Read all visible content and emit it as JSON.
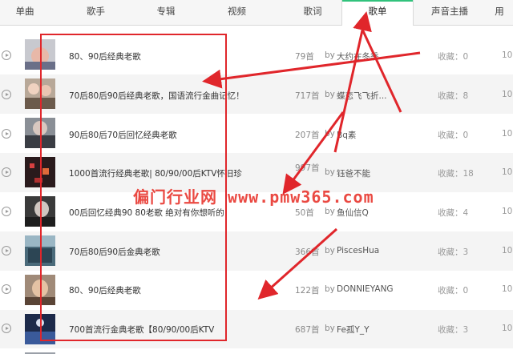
{
  "tabs": [
    {
      "label": "单曲",
      "active": false
    },
    {
      "label": "歌手",
      "active": false
    },
    {
      "label": "专辑",
      "active": false
    },
    {
      "label": "视频",
      "active": false
    },
    {
      "label": "歌词",
      "active": false
    },
    {
      "label": "歌单",
      "active": true
    },
    {
      "label": "声音主播",
      "active": false
    },
    {
      "label": "用",
      "active": false
    }
  ],
  "playlists": [
    {
      "name": "80、90后经典老歌",
      "count": "79首",
      "by": "by",
      "author": "大约在冬季",
      "fav": "收藏：0",
      "edge": "10"
    },
    {
      "name": "70后80后90后经典老歌，国语流行金曲记忆！",
      "count": "717首",
      "by": "by",
      "author": "蝶恋飞飞折...",
      "fav": "收藏：8",
      "edge": "10"
    },
    {
      "name": "90后80后70后回忆经典老歌",
      "count": "207首",
      "by": "by",
      "author": "Bq素",
      "fav": "收藏：0",
      "edge": "10"
    },
    {
      "name": "1000首流行经典老歌| 80/90/00后KTV怀旧珍",
      "count": "997首",
      "by": "by",
      "author": "钰爸不能",
      "fav": "收藏：18",
      "edge": "10"
    },
    {
      "name": "00后回忆经典90 80老歌 绝对有你想听的",
      "count": "50首",
      "by": "by",
      "author": "鱼仙信Q",
      "fav": "收藏：4",
      "edge": "10"
    },
    {
      "name": "70后80后90后金典老歌",
      "count": "366首",
      "by": "by",
      "author": "PiscesHua",
      "fav": "收藏：3",
      "edge": "10"
    },
    {
      "name": "80、90后经典老歌",
      "count": "122首",
      "by": "by",
      "author": "DONNIEYANG",
      "fav": "收藏：0",
      "edge": "10"
    },
    {
      "name": "700首流行金典老歌【80/90/00后KTV",
      "count": "687首",
      "by": "by",
      "author": "Fe孤Y_Y",
      "fav": "收藏：3",
      "edge": "10"
    }
  ],
  "watermark": "偏门行业网 www.pmw365.com",
  "colors": {
    "accent": "#31c27c",
    "annotation_red": "#e0262b",
    "row_alt": "#f4f4f4"
  },
  "icons": {
    "play": "play-circle-icon"
  }
}
